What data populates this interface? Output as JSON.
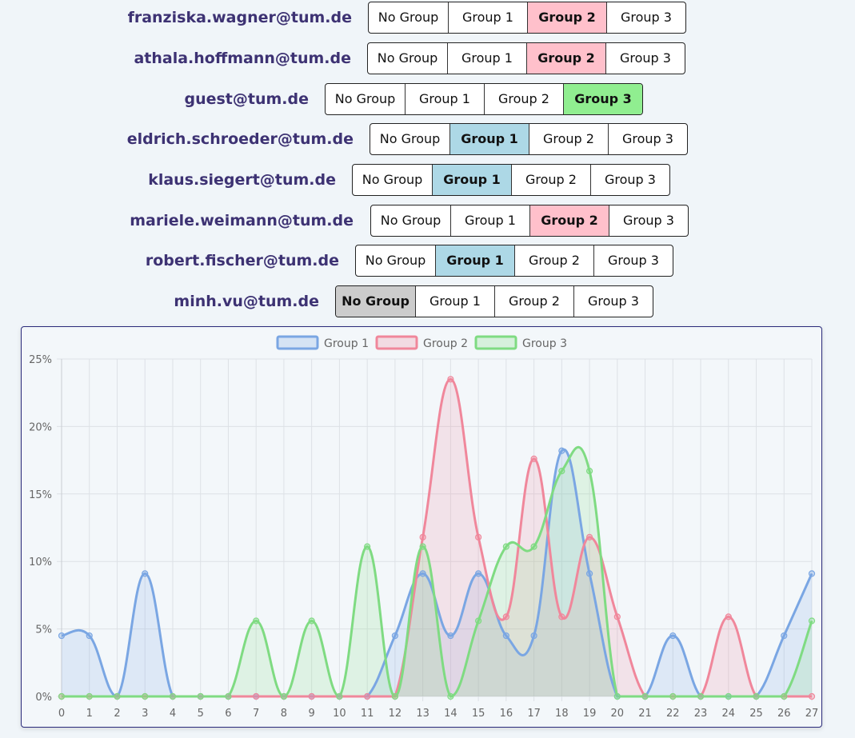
{
  "groups": {
    "options": [
      "No Group",
      "Group 1",
      "Group 2",
      "Group 3"
    ],
    "selected_colors": {
      "No Group": "#cccccc",
      "Group 1": "#add8e6",
      "Group 2": "#ffc0cb",
      "Group 3": "#90ee90"
    }
  },
  "users": [
    {
      "email": "franziska.wagner@tum.de",
      "selected": "Group 2"
    },
    {
      "email": "athala.hoffmann@tum.de",
      "selected": "Group 2"
    },
    {
      "email": "guest@tum.de",
      "selected": "Group 3"
    },
    {
      "email": "eldrich.schroeder@tum.de",
      "selected": "Group 1"
    },
    {
      "email": "klaus.siegert@tum.de",
      "selected": "Group 1"
    },
    {
      "email": "mariele.weimann@tum.de",
      "selected": "Group 2"
    },
    {
      "email": "robert.fischer@tum.de",
      "selected": "Group 1"
    },
    {
      "email": "minh.vu@tum.de",
      "selected": "No Group"
    }
  ],
  "chart_data": {
    "type": "area",
    "categories": [
      "0",
      "1",
      "2",
      "3",
      "4",
      "5",
      "6",
      "7",
      "8",
      "9",
      "10",
      "11",
      "12",
      "13",
      "14",
      "15",
      "16",
      "17",
      "18",
      "19",
      "20",
      "21",
      "22",
      "23",
      "24",
      "25",
      "26",
      "27"
    ],
    "ylim": [
      0,
      25
    ],
    "yticks": [
      "0%",
      "5%",
      "10%",
      "15%",
      "20%",
      "25%"
    ],
    "grid": true,
    "legend_position": "top",
    "series": [
      {
        "name": "Group 1",
        "color": "#7aa6e3",
        "values": [
          4.5,
          4.5,
          0,
          9.1,
          0,
          0,
          0,
          0,
          0,
          0,
          0,
          0,
          4.5,
          9.1,
          4.5,
          9.1,
          4.5,
          4.5,
          18.2,
          9.1,
          0,
          0,
          4.5,
          0,
          0,
          0,
          4.5,
          9.1
        ]
      },
      {
        "name": "Group 2",
        "color": "#f0879b",
        "values": [
          0,
          0,
          0,
          0,
          0,
          0,
          0,
          0,
          0,
          0,
          0,
          0,
          0,
          11.8,
          23.5,
          11.8,
          5.9,
          17.6,
          5.9,
          11.8,
          5.9,
          0,
          0,
          0,
          5.9,
          0,
          0,
          0
        ]
      },
      {
        "name": "Group 3",
        "color": "#7fdb82",
        "values": [
          0,
          0,
          0,
          0,
          0,
          0,
          0,
          5.6,
          0,
          5.6,
          0,
          11.1,
          0,
          11.1,
          0,
          5.6,
          11.1,
          11.1,
          16.7,
          16.7,
          0,
          0,
          0,
          0,
          0,
          0,
          0,
          5.6
        ]
      }
    ]
  }
}
